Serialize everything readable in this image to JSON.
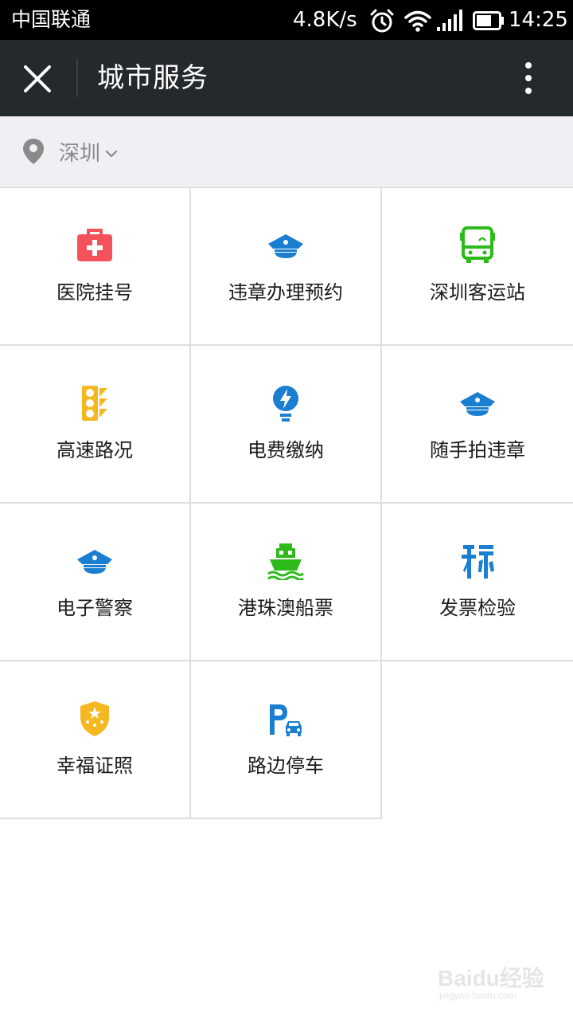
{
  "status_bar": {
    "carrier": "中国联通",
    "net_speed": "4.8K/s",
    "time": "14:25",
    "icons": [
      "alarm-icon",
      "wifi-icon",
      "signal-icon",
      "battery-icon"
    ]
  },
  "toolbar": {
    "title": "城市服务",
    "close_icon": "close-icon",
    "more_icon": "more-vertical-icon"
  },
  "location": {
    "city": "深圳",
    "icon": "location-pin-icon"
  },
  "colors": {
    "toolbar_bg": "#24292b",
    "location_bg": "#efeff4",
    "blue": "#1a7ed1",
    "green": "#2dbb1b",
    "red": "#f4525a",
    "yellow": "#f5b820"
  },
  "services": [
    {
      "label": "医院挂号",
      "icon": "medical-kit-icon"
    },
    {
      "label": "违章办理预约",
      "icon": "police-cap-icon"
    },
    {
      "label": "深圳客运站",
      "icon": "bus-icon"
    },
    {
      "label": "高速路况",
      "icon": "traffic-light-icon"
    },
    {
      "label": "电费缴纳",
      "icon": "electricity-bulb-icon"
    },
    {
      "label": "随手拍违章",
      "icon": "police-cap-icon"
    },
    {
      "label": "电子警察",
      "icon": "police-cap-icon"
    },
    {
      "label": "港珠澳船票",
      "icon": "ship-icon"
    },
    {
      "label": "发票检验",
      "icon": "tax-invoice-icon"
    },
    {
      "label": "幸福证照",
      "icon": "badge-shield-icon"
    },
    {
      "label": "路边停车",
      "icon": "parking-car-icon"
    }
  ],
  "watermark": {
    "brand": "Baidu经验",
    "url": "jingyan.baidu.com"
  }
}
